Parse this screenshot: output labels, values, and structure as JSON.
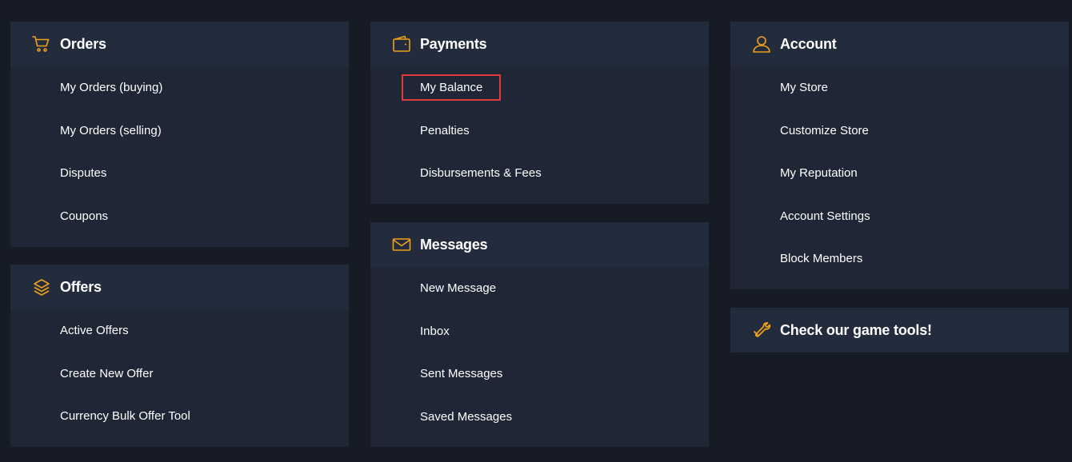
{
  "colors": {
    "background": "#161b26",
    "panel": "#1f2636",
    "header": "#232c3c",
    "accent": "#f0a019",
    "highlight_border": "#e0393e"
  },
  "orders": {
    "icon": "shopping-cart-icon",
    "title": "Orders",
    "items": [
      "My Orders (buying)",
      "My Orders (selling)",
      "Disputes",
      "Coupons"
    ]
  },
  "offers": {
    "icon": "layers-icon",
    "title": "Offers",
    "items": [
      "Active Offers",
      "Create New Offer",
      "Currency Bulk Offer Tool"
    ]
  },
  "payments": {
    "icon": "wallet-icon",
    "title": "Payments",
    "items": [
      "My Balance",
      "Penalties",
      "Disbursements & Fees"
    ],
    "highlighted_item": "My Balance"
  },
  "messages": {
    "icon": "envelope-icon",
    "title": "Messages",
    "items": [
      "New Message",
      "Inbox",
      "Sent Messages",
      "Saved Messages"
    ]
  },
  "account": {
    "icon": "user-icon",
    "title": "Account",
    "items": [
      "My Store",
      "Customize Store",
      "My Reputation",
      "Account Settings",
      "Block Members"
    ]
  },
  "tools": {
    "icon": "wrench-icon",
    "title": "Check our game tools!"
  }
}
